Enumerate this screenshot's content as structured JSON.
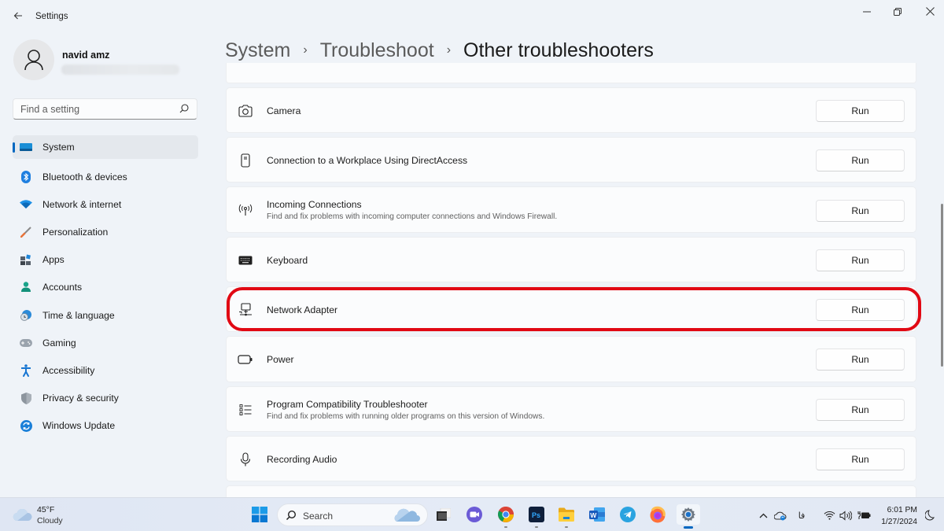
{
  "window": {
    "app_title": "Settings",
    "back_icon": "back-arrow-icon",
    "controls": {
      "minimize": "─",
      "maximize": "❐",
      "close": "✕"
    }
  },
  "profile": {
    "name": "navid amz",
    "email_redacted": true
  },
  "search": {
    "placeholder": "Find a setting",
    "value": ""
  },
  "sidebar": {
    "active_index": 0,
    "items": [
      {
        "label": "System",
        "icon": "system-monitor-icon"
      },
      {
        "label": "Bluetooth & devices",
        "icon": "bluetooth-icon"
      },
      {
        "label": "Network & internet",
        "icon": "wifi-icon"
      },
      {
        "label": "Personalization",
        "icon": "paintbrush-icon"
      },
      {
        "label": "Apps",
        "icon": "apps-icon"
      },
      {
        "label": "Accounts",
        "icon": "accounts-icon"
      },
      {
        "label": "Time & language",
        "icon": "globe-clock-icon"
      },
      {
        "label": "Gaming",
        "icon": "gamepad-icon"
      },
      {
        "label": "Accessibility",
        "icon": "accessibility-icon"
      },
      {
        "label": "Privacy & security",
        "icon": "shield-icon"
      },
      {
        "label": "Windows Update",
        "icon": "update-icon"
      }
    ]
  },
  "breadcrumb": {
    "items": [
      "System",
      "Troubleshoot"
    ],
    "current": "Other troubleshooters",
    "separator": "›"
  },
  "troubleshooters": {
    "run_label": "Run",
    "highlighted_index": 4,
    "highlight_color": "#e10914",
    "items": [
      {
        "title": "Camera",
        "description": "",
        "icon": "camera-icon"
      },
      {
        "title": "Connection to a Workplace Using DirectAccess",
        "description": "",
        "icon": "device-icon"
      },
      {
        "title": "Incoming Connections",
        "description": "Find and fix problems with incoming computer connections and Windows Firewall.",
        "icon": "antenna-icon"
      },
      {
        "title": "Keyboard",
        "description": "",
        "icon": "keyboard-icon"
      },
      {
        "title": "Network Adapter",
        "description": "",
        "icon": "network-adapter-icon"
      },
      {
        "title": "Power",
        "description": "",
        "icon": "battery-icon"
      },
      {
        "title": "Program Compatibility Troubleshooter",
        "description": "Find and fix problems with running older programs on this version of Windows.",
        "icon": "list-icon"
      },
      {
        "title": "Recording Audio",
        "description": "",
        "icon": "microphone-icon"
      }
    ]
  },
  "taskbar": {
    "weather": {
      "temp": "45°F",
      "condition": "Cloudy"
    },
    "search_label": "Search",
    "apps": [
      {
        "name": "start",
        "icon": "windows-start-icon"
      },
      {
        "name": "task-view",
        "icon": "task-view-icon"
      },
      {
        "name": "meet",
        "icon": "video-chat-icon"
      },
      {
        "name": "chrome",
        "icon": "chrome-icon",
        "running": true
      },
      {
        "name": "photoshop",
        "icon": "photoshop-icon",
        "running": true,
        "label": "Ps"
      },
      {
        "name": "file-explorer",
        "icon": "folder-icon",
        "running": true
      },
      {
        "name": "word",
        "icon": "word-icon",
        "label": "W"
      },
      {
        "name": "telegram",
        "icon": "telegram-icon"
      },
      {
        "name": "firefox",
        "icon": "firefox-icon"
      },
      {
        "name": "settings",
        "icon": "settings-gear-icon",
        "active": true
      }
    ],
    "tray": {
      "chevron": "^",
      "language": "فا",
      "time": "6:01 PM",
      "date": "1/27/2024"
    }
  },
  "colors": {
    "accent": "#0067c0",
    "background": "#eff3f8",
    "card": "#fbfcfd",
    "highlight": "#e10914"
  }
}
